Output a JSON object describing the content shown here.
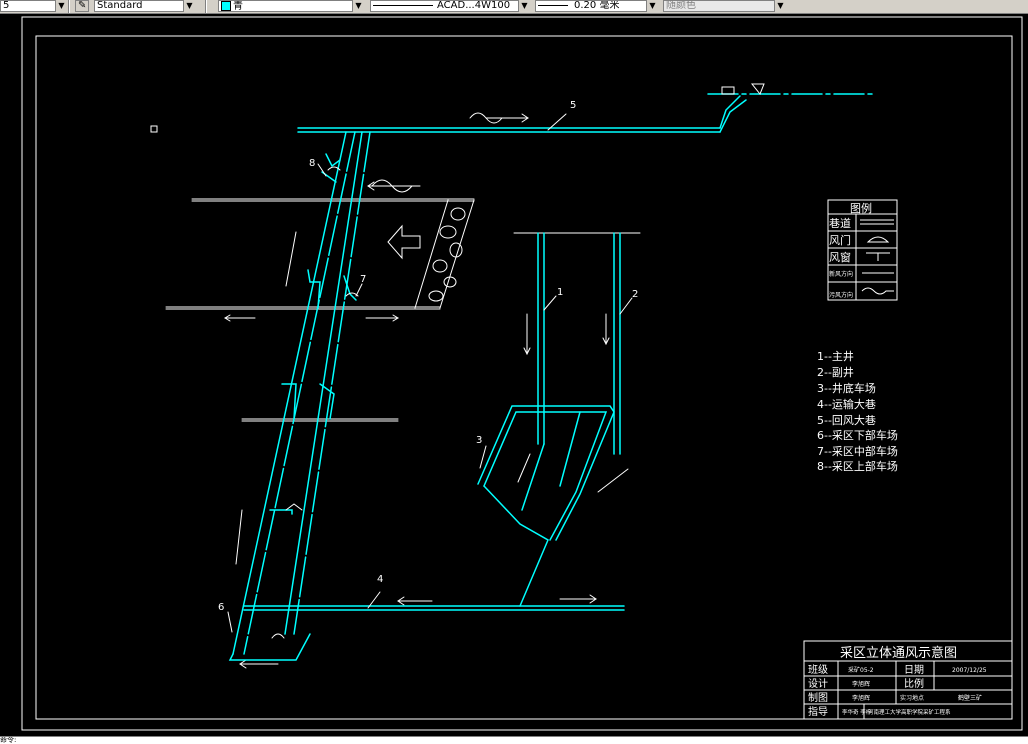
{
  "toolbar": {
    "textstyle_prefix": "5",
    "dimstyle": "Standard",
    "layer": "青",
    "linetype": "ACAD...4W100",
    "lineweight": "0.20 毫米",
    "plotstyle": "随颜色"
  },
  "drawing": {
    "labels": {
      "n1": "1",
      "n2": "2",
      "n3": "3",
      "n4": "4",
      "n5": "5",
      "n6": "6",
      "n7": "7",
      "n8": "8"
    },
    "legend": {
      "title": "图例",
      "items": [
        {
          "label": "巷道",
          "icon": "roadway-symbol-icon"
        },
        {
          "label": "风门",
          "icon": "air-door-symbol-icon"
        },
        {
          "label": "风窗",
          "icon": "air-window-symbol-icon"
        },
        {
          "label": "新风方向",
          "icon": "fresh-air-arrow-icon"
        },
        {
          "label": "污风方向",
          "icon": "foul-air-arrow-icon"
        }
      ]
    },
    "key": [
      "1--主井",
      "2--副井",
      "3--井底车场",
      "4--运输大巷",
      "5--回风大巷",
      "6--采区下部车场",
      "7--采区中部车场",
      "8--采区上部车场"
    ],
    "title_block": {
      "title": "采区立体通风示意图",
      "class_label": "班级",
      "class_value": "采矿05-2",
      "date_label": "日期",
      "date_value": "2007/12/25",
      "design_label": "设计",
      "design_value": "李旭辉",
      "scale_label": "比例",
      "scale_value": "",
      "draw_label": "制图",
      "draw_value": "李旭辉",
      "practice_label": "实习地点",
      "practice_value": "鹤壁三矿",
      "guide_label": "指导",
      "guide_value": "李华奇 李梓",
      "school": "河南理工大学高职学院采矿工程系"
    }
  },
  "command": {
    "prompt": "命令:"
  }
}
